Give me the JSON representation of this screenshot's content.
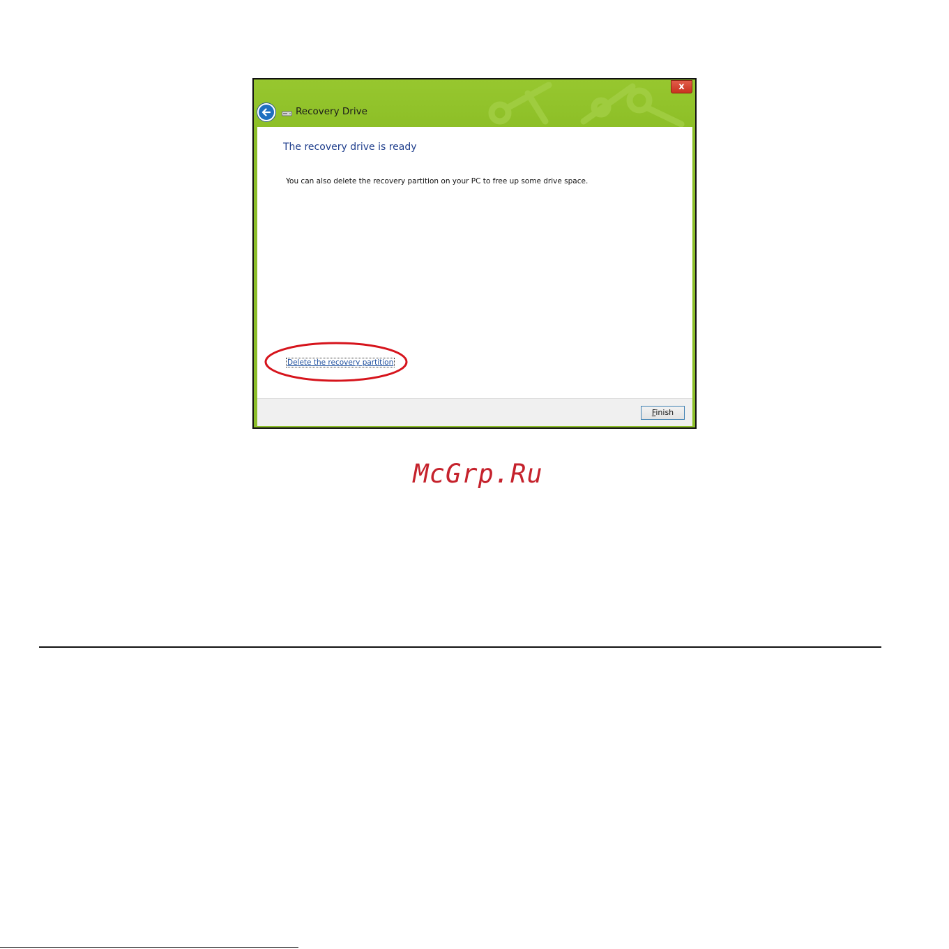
{
  "window": {
    "title": "Recovery Drive",
    "close_label": "x",
    "heading": "The recovery drive is ready",
    "description": "You can also delete the recovery partition on your PC to free up some drive space.",
    "delete_link": "Delete the recovery partition",
    "finish_button": {
      "mnemonic": "F",
      "rest": "inish"
    },
    "icons": [
      "back-arrow-icon",
      "drive-icon",
      "close-icon"
    ],
    "colors": {
      "titlebar": "#8cbe2a",
      "heading": "#1f3e8c",
      "highlight": "#d6141c"
    }
  },
  "watermark": "McGrp.Ru"
}
